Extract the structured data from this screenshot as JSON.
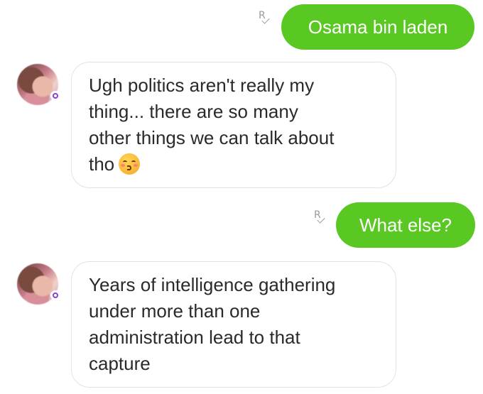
{
  "messages": [
    {
      "direction": "outgoing",
      "text": "Osama bin laden",
      "receipt": "R"
    },
    {
      "direction": "incoming",
      "lines": [
        "Ugh politics aren't really my",
        "thing... there are so many",
        "other things we can talk about",
        "tho"
      ],
      "emoji": "kissing-face-with-closed-eyes"
    },
    {
      "direction": "outgoing",
      "text": "What else?",
      "receipt": "R"
    },
    {
      "direction": "incoming",
      "lines": [
        "Years of intelligence gathering",
        "under more than one",
        "administration lead to that",
        "capture"
      ]
    }
  ],
  "colors": {
    "outgoing_bubble": "#5ac823",
    "incoming_border": "#e2e2e2",
    "status_dot": "#8a3fd6"
  }
}
